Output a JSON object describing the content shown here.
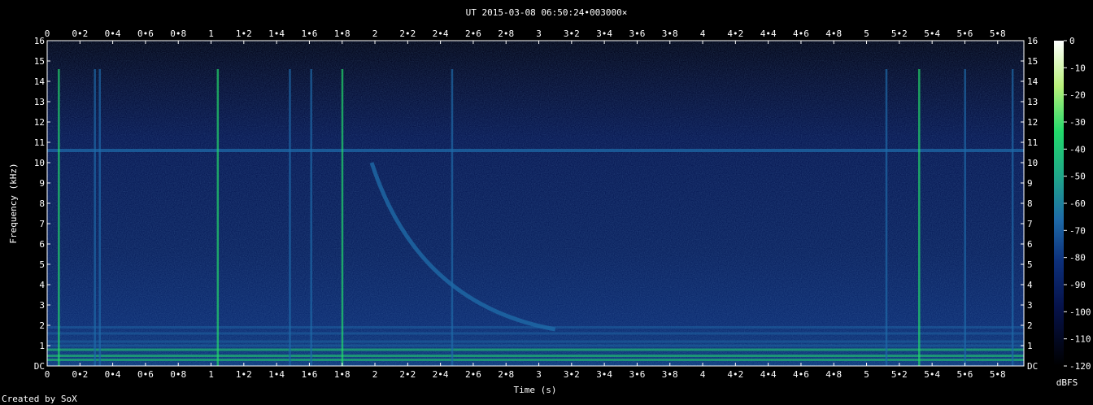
{
  "title": "UT 2015-03-08 06:50:24•003000×",
  "footer": "Created by SoX",
  "chart_data": {
    "type": "heatmap",
    "title": "UT 2015-03-08 06:50:24•003000×",
    "xlabel": "Time (s)",
    "ylabel": "Frequency (kHz)",
    "xlim": [
      0,
      5.96
    ],
    "ylim": [
      0,
      16
    ],
    "x_ticks": [
      "0",
      "0•2",
      "0•4",
      "0•6",
      "0•8",
      "1",
      "1•2",
      "1•4",
      "1•6",
      "1•8",
      "2",
      "2•2",
      "2•4",
      "2•6",
      "2•8",
      "3",
      "3•2",
      "3•4",
      "3•6",
      "3•8",
      "4",
      "4•2",
      "4•4",
      "4•6",
      "4•8",
      "5",
      "5•2",
      "5•4",
      "5•6",
      "5•8"
    ],
    "x_tick_values": [
      0,
      0.2,
      0.4,
      0.6,
      0.8,
      1,
      1.2,
      1.4,
      1.6,
      1.8,
      2,
      2.2,
      2.4,
      2.6,
      2.8,
      3,
      3.2,
      3.4,
      3.6,
      3.8,
      4,
      4.2,
      4.4,
      4.6,
      4.8,
      5,
      5.2,
      5.4,
      5.6,
      5.8
    ],
    "y_ticks": [
      "DC",
      "1",
      "2",
      "3",
      "4",
      "5",
      "6",
      "7",
      "8",
      "9",
      "10",
      "11",
      "12",
      "13",
      "14",
      "15",
      "16"
    ],
    "y_tick_values": [
      0,
      1,
      2,
      3,
      4,
      5,
      6,
      7,
      8,
      9,
      10,
      11,
      12,
      13,
      14,
      15,
      16
    ],
    "colorbar": {
      "label": "dBFS",
      "ticks": [
        "0",
        "-10",
        "-20",
        "-30",
        "-40",
        "-50",
        "-60",
        "-70",
        "-80",
        "-90",
        "-100",
        "-110",
        "-120"
      ],
      "tick_values": [
        0,
        -10,
        -20,
        -30,
        -40,
        -50,
        -60,
        -70,
        -80,
        -90,
        -100,
        -110,
        -120
      ],
      "range": [
        -120,
        0
      ]
    },
    "features": {
      "horizontal_tone_khz": 10.6,
      "low_freq_bands_khz": [
        0.3,
        0.5,
        0.8,
        1.0,
        1.2,
        1.6,
        1.9
      ],
      "vertical_sferics_s": [
        0.07,
        0.29,
        0.32,
        1.04,
        1.48,
        1.61,
        1.8,
        2.47,
        5.12,
        5.32,
        5.6,
        5.89
      ],
      "whistler": {
        "start_s": 1.98,
        "start_khz": 10,
        "end_s": 3.1,
        "end_khz": 1.8
      }
    },
    "colors": {
      "background": "#000000",
      "low": "#06124a",
      "mid": "#1e6aa8",
      "high": "#22d96b",
      "peak": "#ffffff"
    }
  }
}
